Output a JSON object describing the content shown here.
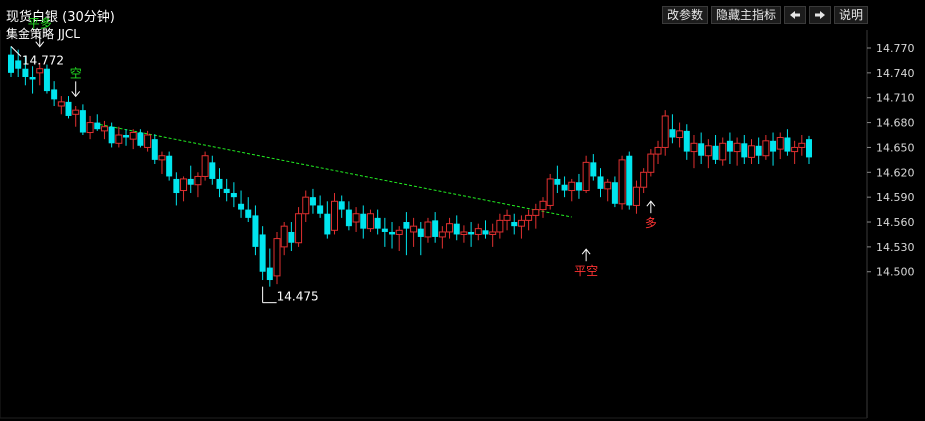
{
  "window": {
    "title": "现货白银 (30分钟)",
    "indicator": "集金策略 JJCL"
  },
  "toolbar": {
    "modify_params": "改参数",
    "hide_indicator": "隐藏主指标",
    "prev_icon": "arrow-left-icon",
    "next_icon": "arrow-right-icon",
    "help": "说明"
  },
  "colors": {
    "background": "#000000",
    "up": "#e03030",
    "down": "#00e5ee",
    "flat": "#ffffff",
    "trendline": "#22ee22",
    "axis": "#3a3a3a",
    "signal_green": "#22dd22",
    "signal_red": "#ff3333"
  },
  "chart_data": {
    "type": "candlestick",
    "ylim": [
      14.475,
      14.78
    ],
    "yticks": [
      "14.770",
      "14.740",
      "14.710",
      "14.680",
      "14.650",
      "14.620",
      "14.590",
      "14.560",
      "14.530",
      "14.500"
    ],
    "candles": [
      [
        14.762,
        14.772,
        14.735,
        14.74
      ],
      [
        14.755,
        14.768,
        14.735,
        14.745
      ],
      [
        14.745,
        14.76,
        14.725,
        14.735
      ],
      [
        14.735,
        14.748,
        14.715,
        14.732
      ],
      [
        14.74,
        14.752,
        14.725,
        14.745
      ],
      [
        14.745,
        14.75,
        14.715,
        14.718
      ],
      [
        14.72,
        14.73,
        14.7,
        14.708
      ],
      [
        14.7,
        14.712,
        14.69,
        14.705
      ],
      [
        14.705,
        14.712,
        14.685,
        14.688
      ],
      [
        14.69,
        14.7,
        14.675,
        14.695
      ],
      [
        14.695,
        14.702,
        14.665,
        14.668
      ],
      [
        14.668,
        14.688,
        14.66,
        14.68
      ],
      [
        14.68,
        14.69,
        14.67,
        14.672
      ],
      [
        14.67,
        14.682,
        14.66,
        14.675
      ],
      [
        14.675,
        14.68,
        14.65,
        14.655
      ],
      [
        14.655,
        14.675,
        14.65,
        14.665
      ],
      [
        14.665,
        14.672,
        14.652,
        14.662
      ],
      [
        14.66,
        14.672,
        14.648,
        14.668
      ],
      [
        14.668,
        14.672,
        14.65,
        14.652
      ],
      [
        14.65,
        14.67,
        14.645,
        14.665
      ],
      [
        14.66,
        14.666,
        14.63,
        14.635
      ],
      [
        14.635,
        14.645,
        14.618,
        14.64
      ],
      [
        14.64,
        14.645,
        14.61,
        14.615
      ],
      [
        14.612,
        14.62,
        14.58,
        14.595
      ],
      [
        14.598,
        14.615,
        14.585,
        14.612
      ],
      [
        14.612,
        14.628,
        14.595,
        14.605
      ],
      [
        14.605,
        14.62,
        14.59,
        14.615
      ],
      [
        14.615,
        14.645,
        14.61,
        14.64
      ],
      [
        14.632,
        14.64,
        14.605,
        14.612
      ],
      [
        14.612,
        14.625,
        14.59,
        14.6
      ],
      [
        14.6,
        14.612,
        14.585,
        14.595
      ],
      [
        14.595,
        14.608,
        14.578,
        14.59
      ],
      [
        14.582,
        14.598,
        14.565,
        14.575
      ],
      [
        14.575,
        14.59,
        14.56,
        14.565
      ],
      [
        14.568,
        14.58,
        14.52,
        14.53
      ],
      [
        14.545,
        14.555,
        14.49,
        14.5
      ],
      [
        14.505,
        14.528,
        14.482,
        14.49
      ],
      [
        14.495,
        14.548,
        14.485,
        14.54
      ],
      [
        14.53,
        14.56,
        14.52,
        14.555
      ],
      [
        14.548,
        14.56,
        14.525,
        14.535
      ],
      [
        14.535,
        14.578,
        14.53,
        14.57
      ],
      [
        14.57,
        14.598,
        14.56,
        14.59
      ],
      [
        14.59,
        14.6,
        14.57,
        14.58
      ],
      [
        14.58,
        14.592,
        14.565,
        14.57
      ],
      [
        14.57,
        14.585,
        14.54,
        14.545
      ],
      [
        14.55,
        14.595,
        14.545,
        14.585
      ],
      [
        14.585,
        14.592,
        14.565,
        14.575
      ],
      [
        14.575,
        14.585,
        14.55,
        14.555
      ],
      [
        14.56,
        14.578,
        14.548,
        14.57
      ],
      [
        14.57,
        14.58,
        14.54,
        14.552
      ],
      [
        14.552,
        14.575,
        14.548,
        14.57
      ],
      [
        14.565,
        14.575,
        14.545,
        14.552
      ],
      [
        14.552,
        14.565,
        14.53,
        14.548
      ],
      [
        14.548,
        14.56,
        14.528,
        14.545
      ],
      [
        14.545,
        14.555,
        14.525,
        14.55
      ],
      [
        14.56,
        14.572,
        14.52,
        14.552
      ],
      [
        14.548,
        14.565,
        14.53,
        14.555
      ],
      [
        14.552,
        14.56,
        14.52,
        14.542
      ],
      [
        14.542,
        14.565,
        14.535,
        14.56
      ],
      [
        14.562,
        14.572,
        14.535,
        14.542
      ],
      [
        14.542,
        14.555,
        14.528,
        14.548
      ],
      [
        14.548,
        14.565,
        14.54,
        14.558
      ],
      [
        14.558,
        14.568,
        14.538,
        14.545
      ],
      [
        14.545,
        14.556,
        14.535,
        14.548
      ],
      [
        14.548,
        14.56,
        14.53,
        14.545
      ],
      [
        14.545,
        14.558,
        14.538,
        14.552
      ],
      [
        14.55,
        14.562,
        14.54,
        14.545
      ],
      [
        14.545,
        14.558,
        14.53,
        14.548
      ],
      [
        14.548,
        14.57,
        14.54,
        14.562
      ],
      [
        14.562,
        14.575,
        14.55,
        14.568
      ],
      [
        14.56,
        14.57,
        14.545,
        14.555
      ],
      [
        14.555,
        14.568,
        14.54,
        14.562
      ],
      [
        14.562,
        14.575,
        14.55,
        14.568
      ],
      [
        14.568,
        14.582,
        14.552,
        14.575
      ],
      [
        14.575,
        14.59,
        14.565,
        14.585
      ],
      [
        14.58,
        14.618,
        14.575,
        14.612
      ],
      [
        14.612,
        14.628,
        14.595,
        14.605
      ],
      [
        14.605,
        14.615,
        14.59,
        14.598
      ],
      [
        14.598,
        14.612,
        14.585,
        14.608
      ],
      [
        14.608,
        14.618,
        14.588,
        14.598
      ],
      [
        14.598,
        14.64,
        14.595,
        14.632
      ],
      [
        14.632,
        14.642,
        14.61,
        14.615
      ],
      [
        14.615,
        14.625,
        14.59,
        14.6
      ],
      [
        14.6,
        14.612,
        14.585,
        14.608
      ],
      [
        14.608,
        14.615,
        14.578,
        14.582
      ],
      [
        14.582,
        14.64,
        14.575,
        14.635
      ],
      [
        14.64,
        14.645,
        14.575,
        14.58
      ],
      [
        14.58,
        14.61,
        14.57,
        14.602
      ],
      [
        14.602,
        14.625,
        14.595,
        14.62
      ],
      [
        14.62,
        14.648,
        14.615,
        14.642
      ],
      [
        14.642,
        14.658,
        14.63,
        14.65
      ],
      [
        14.65,
        14.695,
        14.64,
        14.688
      ],
      [
        14.672,
        14.69,
        14.655,
        14.662
      ],
      [
        14.662,
        14.68,
        14.65,
        14.67
      ],
      [
        14.67,
        14.678,
        14.635,
        14.645
      ],
      [
        14.645,
        14.665,
        14.625,
        14.655
      ],
      [
        14.655,
        14.668,
        14.63,
        14.64
      ],
      [
        14.64,
        14.66,
        14.625,
        14.652
      ],
      [
        14.652,
        14.665,
        14.63,
        14.635
      ],
      [
        14.635,
        14.662,
        14.628,
        14.655
      ],
      [
        14.658,
        14.668,
        14.63,
        14.645
      ],
      [
        14.645,
        14.662,
        14.628,
        14.655
      ],
      [
        14.655,
        14.665,
        14.63,
        14.638
      ],
      [
        14.638,
        14.66,
        14.63,
        14.652
      ],
      [
        14.652,
        14.662,
        14.63,
        14.64
      ],
      [
        14.64,
        14.665,
        14.635,
        14.658
      ],
      [
        14.658,
        14.668,
        14.628,
        14.645
      ],
      [
        14.648,
        14.668,
        14.636,
        14.662
      ],
      [
        14.662,
        14.672,
        14.64,
        14.645
      ],
      [
        14.645,
        14.658,
        14.63,
        14.65
      ],
      [
        14.65,
        14.665,
        14.64,
        14.655
      ],
      [
        14.66,
        14.664,
        14.63,
        14.638
      ]
    ],
    "trendline": {
      "start_index": 11,
      "start_price": 14.68,
      "end_index": 78,
      "end_price": 14.566
    },
    "price_labels": [
      {
        "text": "14.772",
        "index": 0,
        "price": 14.772,
        "at": "high"
      },
      {
        "text": "14.475",
        "index": 35,
        "price": 14.482,
        "at": "low"
      }
    ],
    "signals": [
      {
        "text": "平多",
        "index": 4,
        "price": 14.768,
        "color": "#22dd22",
        "pos": "above",
        "arrow": "down"
      },
      {
        "text": "空",
        "index": 9,
        "price": 14.708,
        "color": "#22dd22",
        "pos": "above",
        "arrow": "down"
      },
      {
        "text": "平空",
        "index": 80,
        "price": 14.532,
        "color": "#ff3333",
        "pos": "below",
        "arrow": "up"
      },
      {
        "text": "多",
        "index": 89,
        "price": 14.59,
        "color": "#ff3333",
        "pos": "below",
        "arrow": "up"
      }
    ],
    "grid": false
  }
}
